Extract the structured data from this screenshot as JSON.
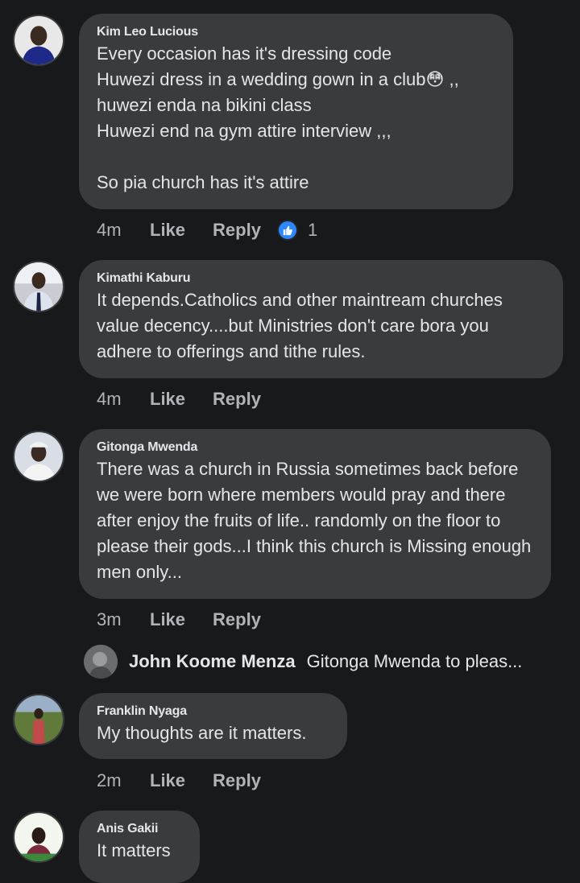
{
  "comments": [
    {
      "author": "Kim Leo Lucious",
      "text": "Every occasion has it's dressing code\nHuwezi dress in a wedding gown in a club",
      "text_tail": " ,,\nhuwezi enda na bikini class\nHuwezi end na gym attire interview ,,,\n\nSo pia church has it's attire",
      "emoji": "😳",
      "time": "4m",
      "like_label": "Like",
      "reply_label": "Reply",
      "reaction_count": "1",
      "reaction_icon": "thumbs-up-icon"
    },
    {
      "author": "Kimathi Kaburu",
      "text": "It depends.Catholics and other maintream churches value decency....but Ministries don't care bora you adhere to offerings and tithe rules.",
      "time": "4m",
      "like_label": "Like",
      "reply_label": "Reply"
    },
    {
      "author": "Gitonga Mwenda",
      "text": "There was a church in Russia sometimes back before we were born where members would pray and there after enjoy the fruits of life.. randomly on the floor to please their gods...I think this church is Missing enough men only...",
      "time": "3m",
      "like_label": "Like",
      "reply_label": "Reply"
    },
    {
      "author": "Franklin Nyaga",
      "text": "My thoughts are it matters.",
      "time": "2m",
      "like_label": "Like",
      "reply_label": "Reply"
    },
    {
      "author": "Anis Gakii",
      "text": "It matters"
    }
  ],
  "reply_preview": {
    "author": "John Koome Menza",
    "text": "Gitonga Mwenda to pleas..."
  },
  "colors": {
    "background": "#18191a",
    "bubble": "#3a3b3c",
    "text_primary": "#e4e6eb",
    "text_secondary": "#b0b3b8",
    "reaction_blue": "#2d88ff"
  }
}
